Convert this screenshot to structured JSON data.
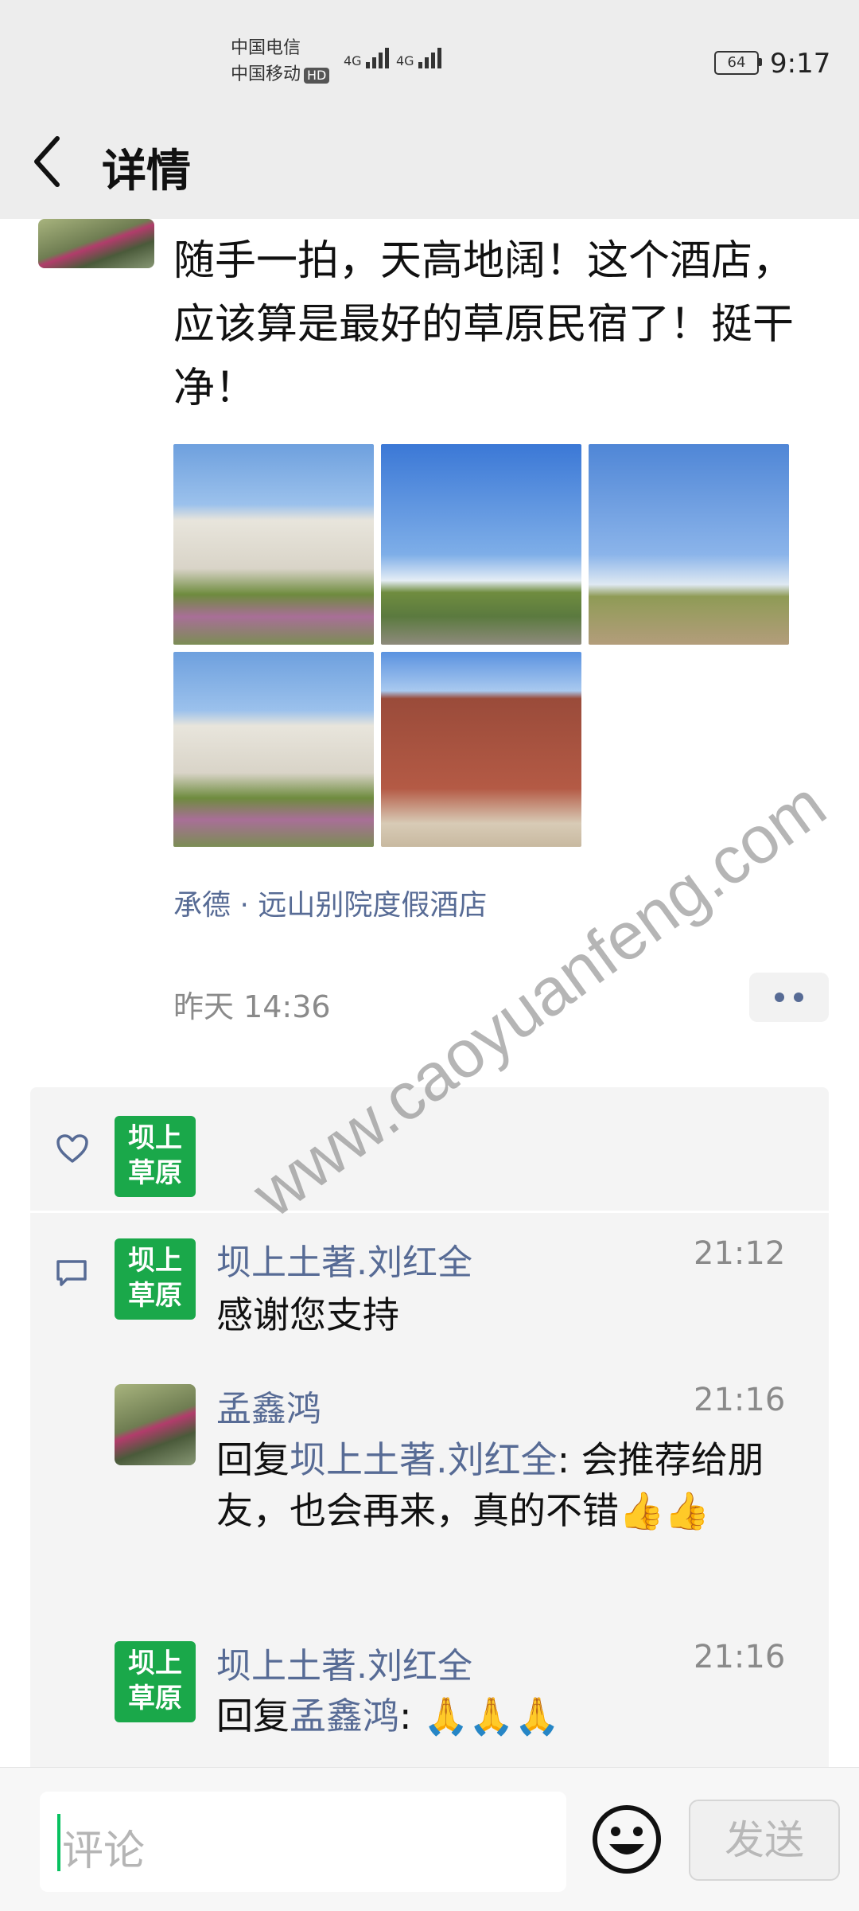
{
  "status_bar": {
    "carrier1": "中国电信",
    "carrier2": "中国移动",
    "hd": "HD",
    "net1": "4G",
    "net2": "4G",
    "battery": "64",
    "time": "9:17"
  },
  "nav": {
    "back_icon": "chevron-left",
    "title": "详情"
  },
  "post": {
    "text": "随手一拍，天高地阔！这个酒店，应该算是最好的草原民宿了！挺干净！",
    "location": "承德 · 远山别院度假酒店",
    "time": "昨天 14:36"
  },
  "likes": {
    "icon": "heart-outline",
    "avatar_text_line1": "坝上",
    "avatar_text_line2": "草原"
  },
  "comments": {
    "icon": "comment-bubble",
    "items": [
      {
        "name": "坝上土著.刘红全",
        "time": "21:12",
        "text": "感谢您支持"
      },
      {
        "name": "孟鑫鸿",
        "time": "21:16",
        "reply_prefix": "回复",
        "reply_to": "坝上土著.刘红全",
        "text": ": 会推荐给朋友，也会再来，真的不错",
        "emoji": "👍👍"
      },
      {
        "name": "坝上土著.刘红全",
        "time": "21:16",
        "reply_prefix": "回复",
        "reply_to": "孟鑫鸿",
        "text": ": ",
        "emoji": "🙏🙏🙏"
      }
    ]
  },
  "bottom": {
    "placeholder": "评论",
    "emoji_icon": "smiley-face",
    "send_label": "发送"
  },
  "watermark": "www.caoyuanfeng.com",
  "colors": {
    "link": "#576b95",
    "wechat_green": "#07c160",
    "avatar_green": "#1aa84a"
  }
}
